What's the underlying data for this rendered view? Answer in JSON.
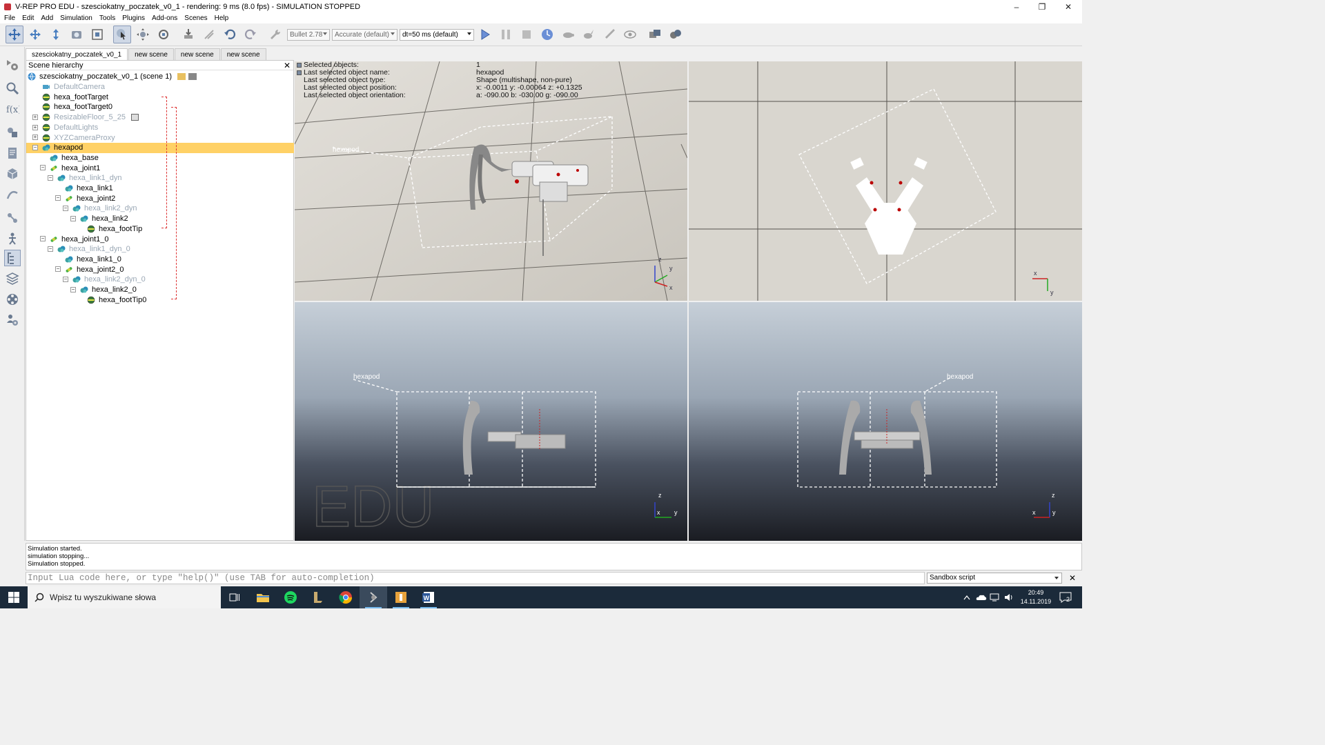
{
  "window": {
    "title": "V-REP PRO EDU - szesciokatny_poczatek_v0_1 - rendering: 9 ms (8.0 fps) - SIMULATION STOPPED",
    "controls": {
      "minimize": "–",
      "restore": "❐",
      "close": "✕"
    }
  },
  "menu": [
    "File",
    "Edit",
    "Add",
    "Simulation",
    "Tools",
    "Plugins",
    "Add-ons",
    "Scenes",
    "Help"
  ],
  "toolbar": {
    "engine": "Bullet 2.78",
    "accuracy": "Accurate (default)",
    "timestep": "dt=50 ms (default)"
  },
  "tabs": [
    "szesciokatny_poczatek_v0_1",
    "new scene",
    "new scene",
    "new scene"
  ],
  "hierarchy": {
    "title": "Scene hierarchy",
    "close": "✕",
    "items": [
      {
        "label": "szesciokatny_poczatek_v0_1 (scene 1)",
        "icon": "scene-icon",
        "dim": false
      },
      {
        "label": "DefaultCamera",
        "icon": "camera-icon",
        "dim": true
      },
      {
        "label": "hexa_footTarget",
        "icon": "dummy-icon",
        "dim": false
      },
      {
        "label": "hexa_footTarget0",
        "icon": "dummy-icon",
        "dim": false
      },
      {
        "label": "ResizableFloor_5_25",
        "icon": "dummy-icon",
        "dim": true
      },
      {
        "label": "DefaultLights",
        "icon": "dummy-icon",
        "dim": true
      },
      {
        "label": "XYZCameraProxy",
        "icon": "dummy-icon",
        "dim": true
      },
      {
        "label": "hexapod",
        "icon": "shape-icon",
        "dim": false
      },
      {
        "label": "hexa_base",
        "icon": "shape-icon",
        "dim": false
      },
      {
        "label": "hexa_joint1",
        "icon": "joint-icon",
        "dim": false
      },
      {
        "label": "hexa_link1_dyn",
        "icon": "shape-icon",
        "dim": true
      },
      {
        "label": "hexa_link1",
        "icon": "shape-icon",
        "dim": false
      },
      {
        "label": "hexa_joint2",
        "icon": "joint-icon",
        "dim": false
      },
      {
        "label": "hexa_link2_dyn",
        "icon": "shape-icon",
        "dim": true
      },
      {
        "label": "hexa_link2",
        "icon": "shape-icon",
        "dim": false
      },
      {
        "label": "hexa_footTip",
        "icon": "dummy-icon",
        "dim": false
      },
      {
        "label": "hexa_joint1_0",
        "icon": "joint-icon",
        "dim": false
      },
      {
        "label": "hexa_link1_dyn_0",
        "icon": "shape-icon",
        "dim": true
      },
      {
        "label": "hexa_link1_0",
        "icon": "shape-icon",
        "dim": false
      },
      {
        "label": "hexa_joint2_0",
        "icon": "joint-icon",
        "dim": false
      },
      {
        "label": "hexa_link2_dyn_0",
        "icon": "shape-icon",
        "dim": true
      },
      {
        "label": "hexa_link2_0",
        "icon": "shape-icon",
        "dim": false
      },
      {
        "label": "hexa_footTip0",
        "icon": "dummy-icon",
        "dim": false
      }
    ]
  },
  "info": {
    "rows": [
      {
        "label": "Selected objects:",
        "value": "1"
      },
      {
        "label": "Last selected object name:",
        "value": "hexapod"
      },
      {
        "label": "Last selected object type:",
        "value": "Shape (multishape, non-pure)"
      },
      {
        "label": "Last selected object position:",
        "value": "x: -0.0011    y: -0.00064    z: +0.1325"
      },
      {
        "label": "Last selected object orientation:",
        "value": "a: -090.00    b: -030.00    g: -090.00"
      }
    ]
  },
  "viewports": {
    "label_hexapod": "hexapod",
    "watermark": "EDU",
    "axis": {
      "x": "x",
      "y": "y",
      "z": "z"
    }
  },
  "console": {
    "lines": [
      "Simulation started.",
      "simulation stopping...",
      "Simulation stopped."
    ]
  },
  "lua": {
    "placeholder": "Input Lua code here, or type \"help()\" (use TAB for auto-completion)",
    "script_select": "Sandbox script",
    "close": "✕"
  },
  "taskbar": {
    "search_placeholder": "Wpisz tu wyszukiwane słowa",
    "time": "20:49",
    "date": "14.11.2019",
    "notifications": "2"
  }
}
